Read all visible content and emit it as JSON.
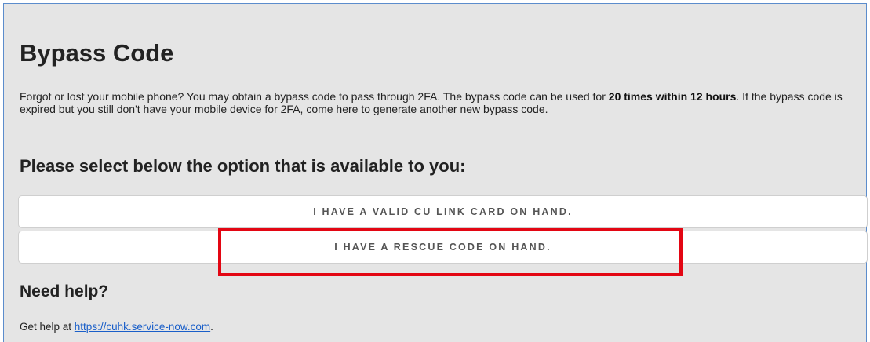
{
  "page": {
    "title": "Bypass Code",
    "intro": {
      "text_1": "Forgot or lost your mobile phone? You may obtain a bypass code to pass through 2FA. The bypass code can be used for ",
      "bold": "20 times within 12 hours",
      "text_2": ". If the bypass code is expired but you still don't have your mobile device for 2FA, come here to generate another new bypass code."
    },
    "select_heading": "Please select below the option that is available to you:",
    "options": [
      {
        "label": "I HAVE A VALID CU LINK CARD ON HAND."
      },
      {
        "label": "I HAVE A RESCUE CODE ON HAND."
      }
    ],
    "help": {
      "heading": "Need help?",
      "prefix": "Get help at ",
      "link_text": "https://cuhk.service-now.com",
      "suffix": "."
    }
  },
  "colors": {
    "background": "#e5e5e5",
    "frame_border": "#5b8ccc",
    "highlight": "#e30613",
    "link": "#1a5fc9"
  }
}
